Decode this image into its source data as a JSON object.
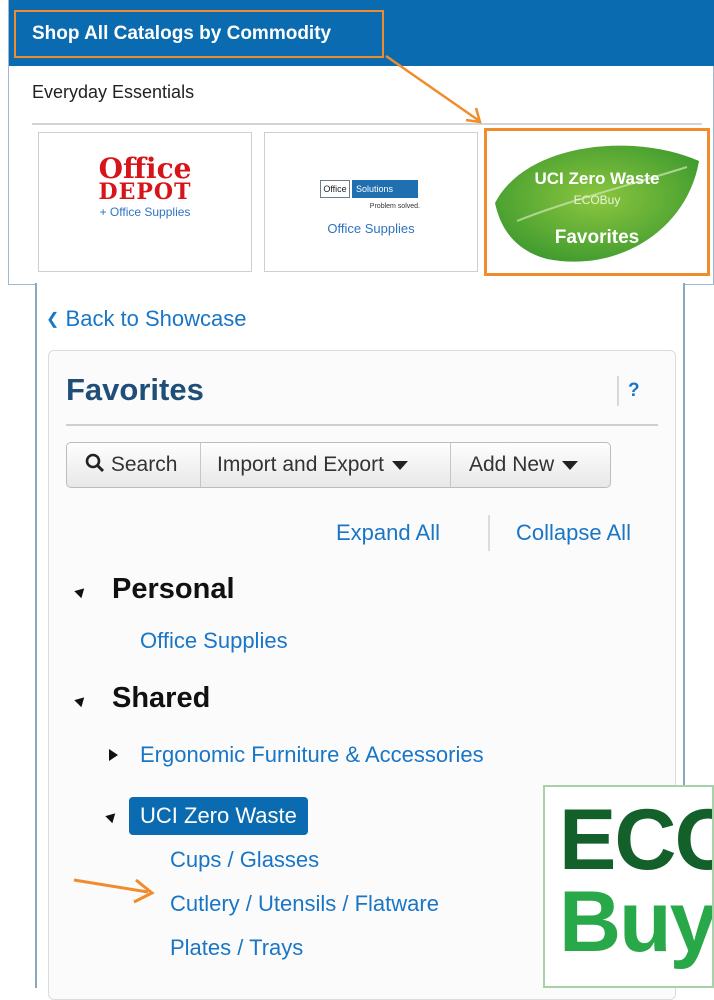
{
  "header": {
    "title": "Shop All Catalogs by Commodity"
  },
  "showcase": {
    "section_label": "Everyday Essentials",
    "tiles": [
      {
        "logo_line1": "Office",
        "logo_line2": "DEPOT",
        "subtitle": "+ Office Supplies"
      },
      {
        "logo_left": "Office",
        "logo_right": "Solutions",
        "tagline": "Problem solved.",
        "subtitle": "Office Supplies"
      },
      {
        "title": "UCI Zero Waste",
        "subtitle": "ECOBuy",
        "label": "Favorites",
        "leaf_icon": "leaf-icon"
      }
    ]
  },
  "favorites": {
    "back_link": "Back to Showcase",
    "title": "Favorites",
    "help": "?",
    "toolbar": {
      "search": "Search",
      "search_icon": "search-icon",
      "import_export": "Import and Export",
      "add_new": "Add New"
    },
    "expand_all": "Expand All",
    "collapse_all": "Collapse All",
    "groups": [
      {
        "title": "Personal",
        "items": [
          "Office Supplies"
        ]
      },
      {
        "title": "Shared",
        "folders": [
          {
            "label": "Ergonomic Furniture & Accessories",
            "expanded": false
          },
          {
            "label": "UCI Zero Waste",
            "expanded": true,
            "selected": true,
            "items": [
              "Cups / Glasses",
              "Cutlery / Utensils / Flatware",
              "Plates / Trays"
            ]
          }
        ]
      }
    ]
  },
  "eco_logo": {
    "line1": "ECO",
    "line2": "Buy"
  },
  "colors": {
    "header_blue": "#0a6bb0",
    "link_blue": "#1976c7",
    "highlight_orange": "#f08c2c",
    "eco_green": "#1c8f3a"
  }
}
